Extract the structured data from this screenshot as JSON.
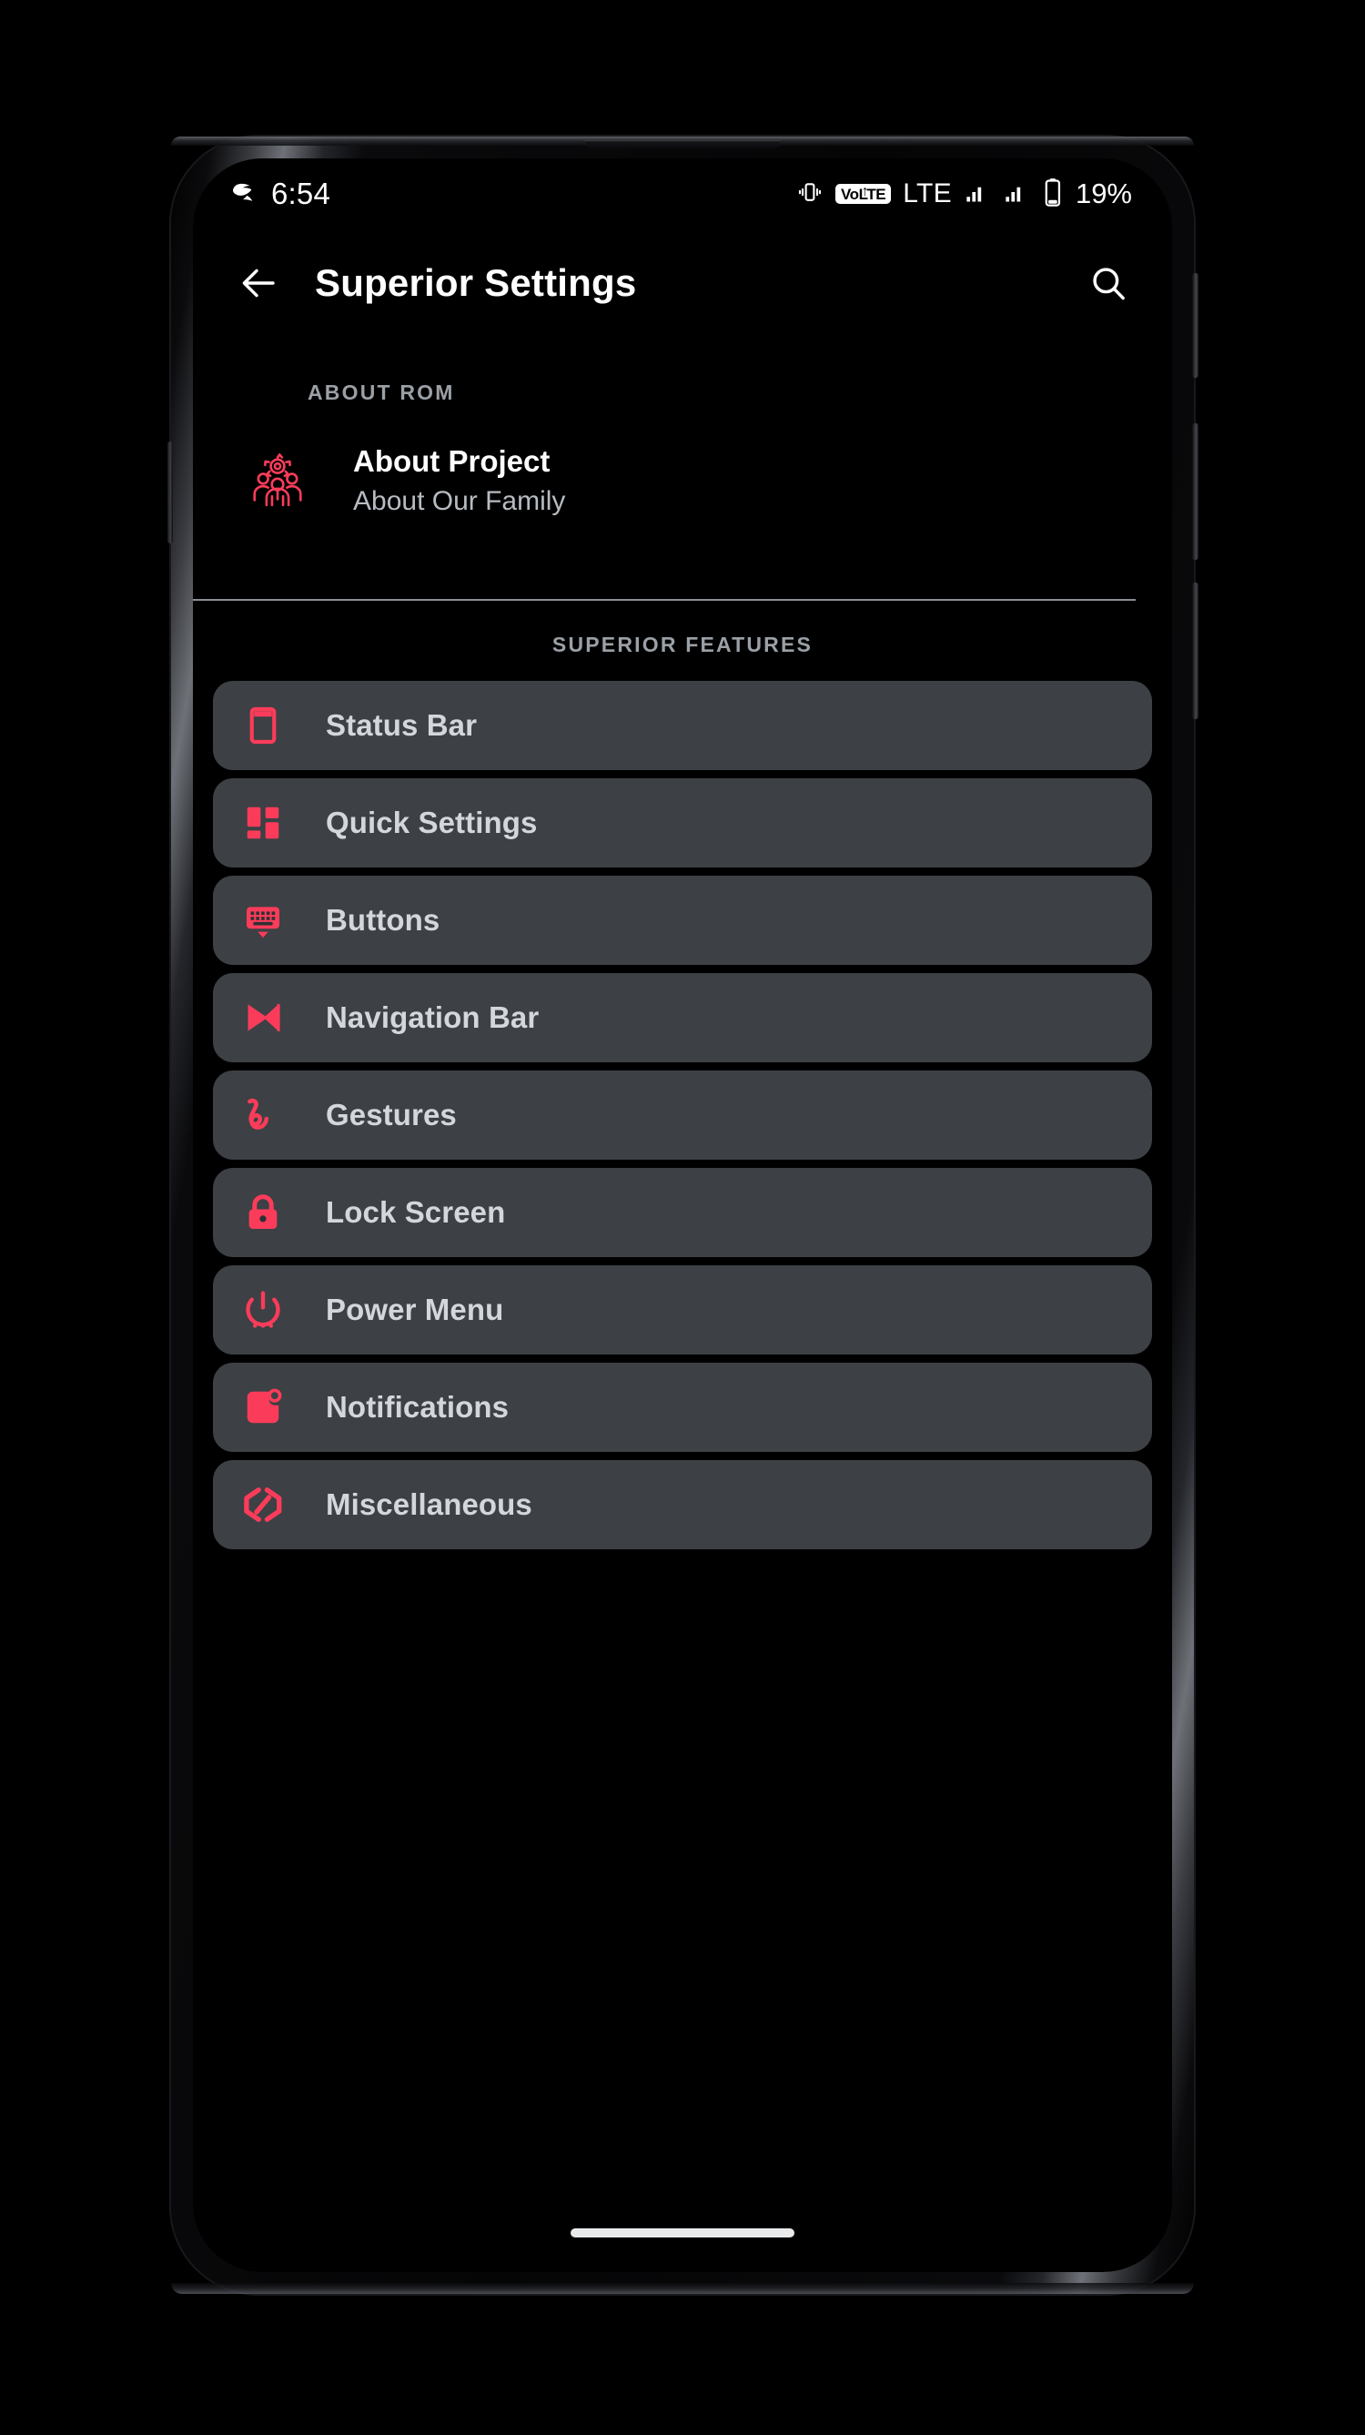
{
  "theme": {
    "accent": "#fa3c5a",
    "card_bg": "#3d4044",
    "screen_bg": "#000000",
    "label_color": "#d3d7db",
    "section_header_color": "#9aa0a6"
  },
  "status_bar": {
    "clock": "6:54",
    "notification_icon": "app-logo-icon",
    "vibrate_icon": "vibrate-icon",
    "volte_label": "VoLTE",
    "network_label": "LTE",
    "signal_icon_1": "signal-bars-icon",
    "signal_icon_2": "signal-bars-icon",
    "battery_icon": "battery-icon",
    "battery_percent": "19%"
  },
  "toolbar": {
    "back_icon": "arrow-left-icon",
    "title": "Superior Settings",
    "search_icon": "search-icon"
  },
  "about_section": {
    "header": "ABOUT ROM",
    "item": {
      "icon": "people-gear-icon",
      "title": "About Project",
      "summary": "About Our Family"
    }
  },
  "features_section": {
    "header": "SUPERIOR FEATURES",
    "items": [
      {
        "label": "Status Bar",
        "icon": "status-bar-icon"
      },
      {
        "label": "Quick Settings",
        "icon": "quick-settings-grid-icon"
      },
      {
        "label": "Buttons",
        "icon": "keyboard-icon"
      },
      {
        "label": "Navigation Bar",
        "icon": "skip-next-icon"
      },
      {
        "label": "Gestures",
        "icon": "gesture-squiggle-icon"
      },
      {
        "label": "Lock Screen",
        "icon": "lock-icon"
      },
      {
        "label": "Power Menu",
        "icon": "power-icon"
      },
      {
        "label": "Notifications",
        "icon": "notification-badge-icon"
      },
      {
        "label": "Miscellaneous",
        "icon": "code-brackets-icon"
      }
    ]
  },
  "navigation": {
    "gesture_pill": "home-gesture-pill"
  }
}
